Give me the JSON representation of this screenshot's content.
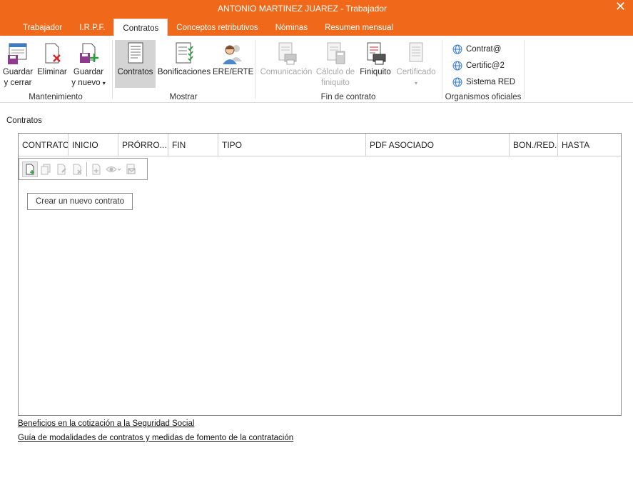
{
  "window": {
    "title": "ANTONIO MARTINEZ JUAREZ - Trabajador",
    "close_label": "✕"
  },
  "tabs": [
    {
      "label": "Trabajador"
    },
    {
      "label": "I.R.P.F."
    },
    {
      "label": "Contratos"
    },
    {
      "label": "Conceptos retributivos"
    },
    {
      "label": "Nóminas"
    },
    {
      "label": "Resumen mensual"
    }
  ],
  "ribbon": {
    "mantenimiento": {
      "label": "Mantenimiento",
      "guardar_cerrar": "Guardar\ny cerrar",
      "eliminar": "Eliminar",
      "guardar_nuevo": "Guardar\ny nuevo",
      "guardar_nuevo_arrow": "▾"
    },
    "mostrar": {
      "label": "Mostrar",
      "contratos": "Contratos",
      "bonificaciones": "Bonificaciones",
      "ere_erte": "ERE/ERTE"
    },
    "fin_contrato": {
      "label": "Fin de contrato",
      "comunicacion": "Comunicación",
      "calculo_finiquito": "Cálculo de\nfiniquito",
      "finiquito": "Finiquito",
      "certificado": "Certificado",
      "certificado_arrow": "▾"
    },
    "organismos": {
      "label": "Organismos oficiales",
      "contrata": "Contrat@",
      "certifica": "Certific@2",
      "sistema_red": "Sistema RED"
    }
  },
  "main": {
    "section_title": "Contratos",
    "columns": [
      "CONTRATO",
      "INICIO",
      "PRÓRRO...",
      "FIN",
      "TIPO",
      "PDF ASOCIADO",
      "BON./RED.",
      "HASTA"
    ],
    "new_contract_label": "Crear un nuevo contrato",
    "links": [
      "Beneficios en la cotización a la Seguridad Social",
      "Guía de modalidades de contratos y medidas de fomento de la contratación"
    ]
  },
  "colors": {
    "accent": "#f0681a",
    "selected": "#d4d4d4"
  }
}
